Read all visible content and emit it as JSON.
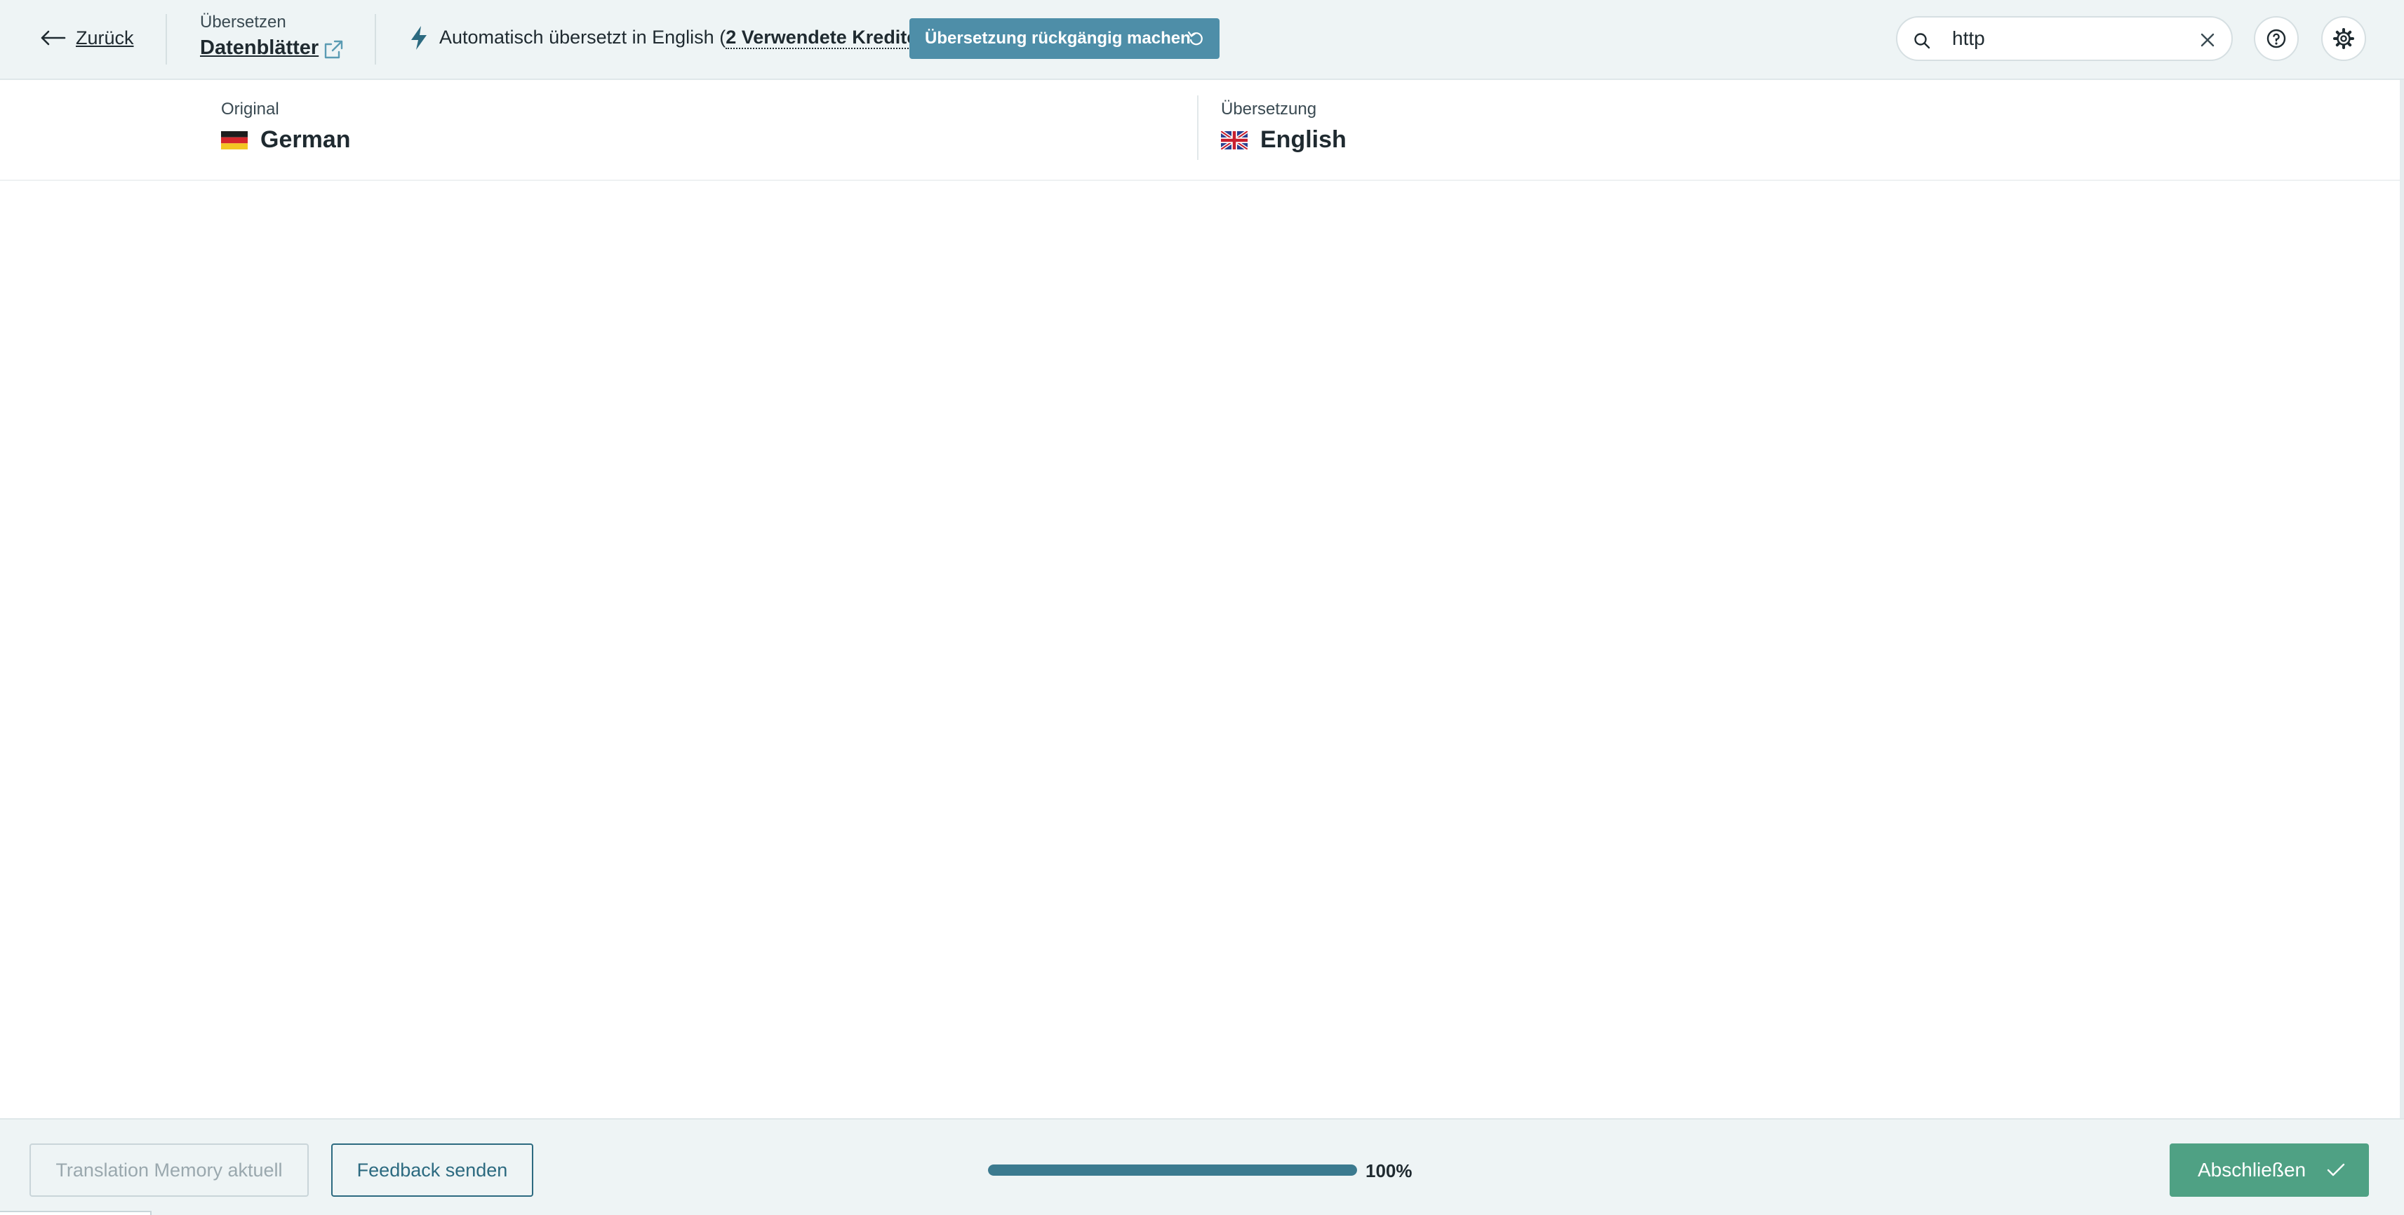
{
  "topbar": {
    "back_label": "Zurück",
    "breadcrumb_small": "Übersetzen",
    "breadcrumb_title": "Datenblätter",
    "auto_prefix": "Automatisch übersetzt in English (",
    "auto_credits": "2 Verwendete Kredite",
    "auto_suffix": ")",
    "undo_label": "Übersetzung rückgängig machen",
    "search_value": "http",
    "icons": [
      "arrow-left-icon",
      "external-link-icon",
      "lightning-icon",
      "undo-icon",
      "search-icon",
      "close-icon",
      "help-icon",
      "gear-icon"
    ]
  },
  "languages": {
    "source_label": "Original",
    "source_name": "German",
    "target_label": "Übersetzung",
    "target_name": "English"
  },
  "footer": {
    "tm_label": "Translation Memory aktuell",
    "feedback_label": "Feedback senden",
    "progress_fraction": 1.0,
    "progress_text": "100%",
    "finish_label": "Abschließen"
  },
  "colors": {
    "topbar_bg": "#eef4f5",
    "undo_button": "#4e8ea8",
    "finish_button": "#4fa184",
    "progress_fill": "#3b7a8f",
    "feedback_border": "#2c6a80"
  }
}
